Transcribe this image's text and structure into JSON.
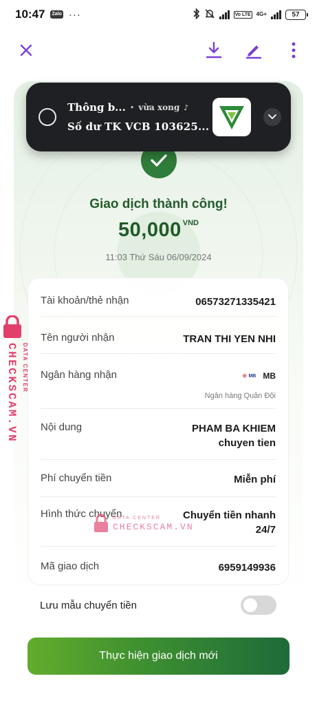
{
  "status_bar": {
    "time": "10:47",
    "zalo": "Zalo",
    "more": "···",
    "volte": "Vo LTE",
    "network": "4G+",
    "battery": "57"
  },
  "notification": {
    "title": "Thông b...",
    "time": "vừa xong",
    "body": "Số dư TK VCB 103625..."
  },
  "receipt": {
    "status": "Giao dịch thành công!",
    "amount": "50,000",
    "currency": "VND",
    "datetime": "11:03 Thứ Sáu 06/09/2024"
  },
  "details": [
    {
      "label": "Tài khoản/thẻ nhận",
      "value": "06573271335421"
    },
    {
      "label": "Tên người nhận",
      "value": "TRAN THI YEN NHI"
    },
    {
      "label": "Ngân hàng nhận",
      "value": "MB",
      "sub": "Ngân hàng Quân Đội",
      "logo": "MB"
    },
    {
      "label": "Nội dung",
      "value": "PHAM BA KHIEM",
      "value2": "chuyen tien"
    },
    {
      "label": "Phí chuyển tiền",
      "value": "Miễn phí"
    },
    {
      "label": "Hình thức chuyển",
      "value": "Chuyển tiền nhanh",
      "value2": "24/7"
    },
    {
      "label": "Mã giao dịch",
      "value": "6959149936"
    }
  ],
  "save_template": {
    "label": "Lưu mẫu chuyển tiền",
    "enabled": false
  },
  "new_transaction_button": "Thực hiện giao dịch mới",
  "watermark": {
    "small": "DATA CENTER",
    "big": "CHECKSCAM.VN"
  },
  "colors": {
    "brand_green": "#2f7d3b",
    "accent_purple": "#7b3fd6",
    "watermark_pink": "#e2567e"
  }
}
